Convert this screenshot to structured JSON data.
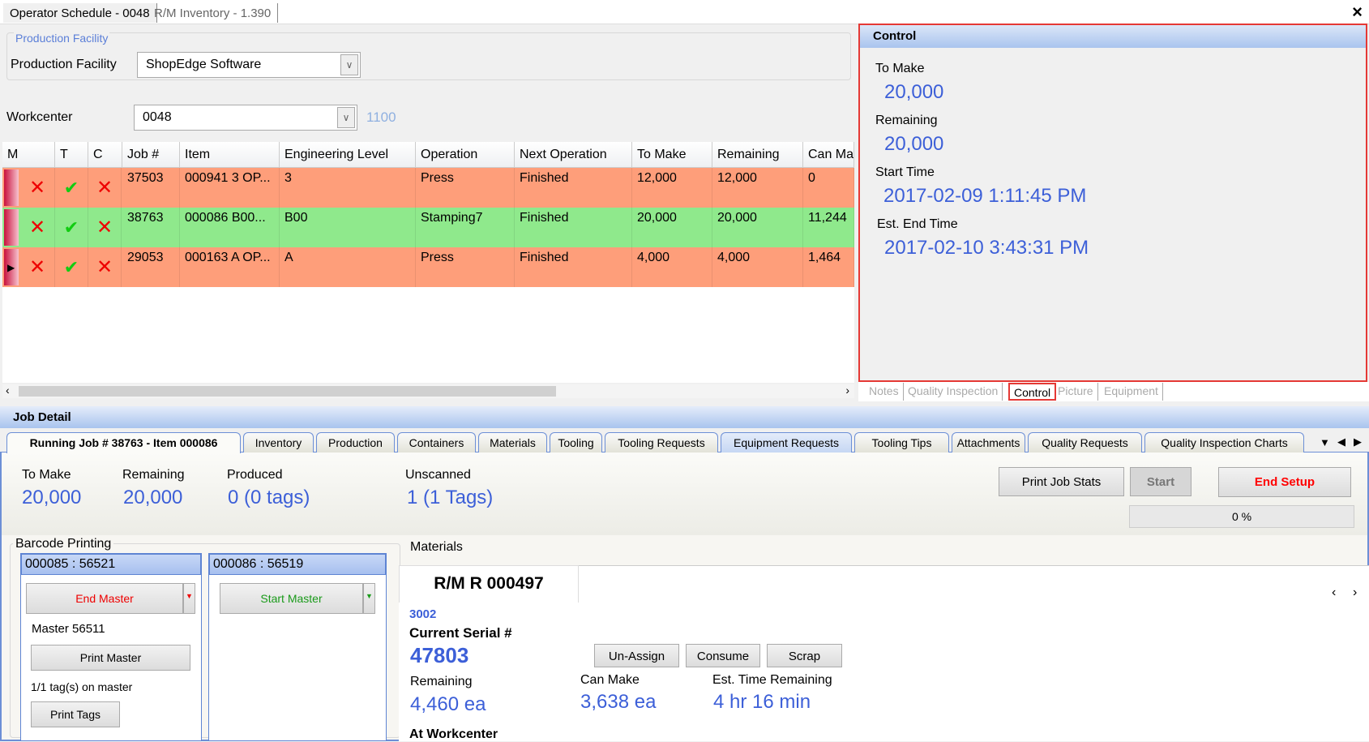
{
  "window": {
    "tabs": [
      "Operator Schedule - 0048",
      "R/M Inventory - 1.390"
    ],
    "close": "×"
  },
  "facility": {
    "group_title": "Production Facility",
    "label": "Production Facility",
    "value": "ShopEdge Software"
  },
  "workcenter": {
    "label": "Workcenter",
    "value": "0048",
    "code": "1100"
  },
  "grid": {
    "columns": [
      "M",
      "T",
      "C",
      "Job #",
      "Item",
      "Engineering Level",
      "Operation",
      "Next Operation",
      "To Make",
      "Remaining",
      "Can Ma"
    ],
    "rows": [
      {
        "job": "37503",
        "item": "000941  3  OP...",
        "eng": "3",
        "op": "Press",
        "next": "Finished",
        "to_make": "12,000",
        "remaining": "12,000",
        "can_make": "0",
        "color": "#fe9e7a",
        "t": "check",
        "m": "x",
        "c": "x"
      },
      {
        "job": "38763",
        "item": "000086  B00...",
        "eng": "B00",
        "op": "Stamping7",
        "next": "Finished",
        "to_make": "20,000",
        "remaining": "20,000",
        "can_make": "11,244",
        "color": "#8fe98c",
        "t": "check",
        "m": "x",
        "c": "x"
      },
      {
        "job": "29053",
        "item": "000163  A  OP...",
        "eng": "A",
        "op": "Press",
        "next": "Finished",
        "to_make": "4,000",
        "remaining": "4,000",
        "can_make": "1,464",
        "color": "#fe9e7a",
        "t": "check",
        "m": "x",
        "c": "x"
      }
    ]
  },
  "control": {
    "title": "Control",
    "to_make_label": "To Make",
    "to_make": "20,000",
    "remaining_label": "Remaining",
    "remaining": "20,000",
    "start_label": "Start Time",
    "start": "2017-02-09 1:11:45 PM",
    "end_label": "Est. End Time",
    "end": "2017-02-10 3:43:31 PM"
  },
  "side_tabs": [
    "Notes",
    "Quality Inspection",
    "Control",
    "Picture",
    "Equipment"
  ],
  "job_detail": {
    "title": "Job Detail",
    "tabs": [
      "Running Job # 38763 - Item 000086",
      "Inventory",
      "Production",
      "Containers",
      "Materials",
      "Tooling",
      "Tooling Requests",
      "Equipment Requests",
      "Tooling Tips",
      "Attachments",
      "Quality Requests",
      "Quality Inspection Charts"
    ],
    "stats": {
      "to_make_label": "To Make",
      "to_make": "20,000",
      "remaining_label": "Remaining",
      "remaining": "20,000",
      "produced_label": "Produced",
      "produced": "0 (0 tags)",
      "unscanned_label": "Unscanned",
      "unscanned": "1 (1 Tags)"
    },
    "buttons": {
      "print_job_stats": "Print Job Stats",
      "start": "Start",
      "end_setup": "End Setup"
    },
    "progress": {
      "label": "0 %",
      "value": 0
    },
    "barcode": {
      "title": "Barcode Printing",
      "panel1": {
        "header": "000085 : 56521",
        "end_master": "End Master",
        "master": "Master 56511",
        "print_master": "Print Master",
        "tags_info": "1/1 tag(s) on master",
        "print_tags": "Print Tags"
      },
      "panel2": {
        "header": "000086 : 56519",
        "start_master": "Start Master"
      }
    },
    "materials": {
      "title": "Materials",
      "tab": "R/M R 000497",
      "code": "3002",
      "serial_label": "Current Serial #",
      "serial": "47803",
      "unassign": "Un-Assign",
      "consume": "Consume",
      "scrap": "Scrap",
      "remaining_label": "Remaining",
      "remaining": "4,460 ea",
      "can_make_label": "Can Make",
      "can_make": "3,638 ea",
      "time_label": "Est. Time Remaining",
      "time": "4 hr 16 min",
      "at_wc": "At Workcenter"
    }
  },
  "colors": {
    "accent": "#3c5fd8",
    "highlight": "#e53935"
  }
}
